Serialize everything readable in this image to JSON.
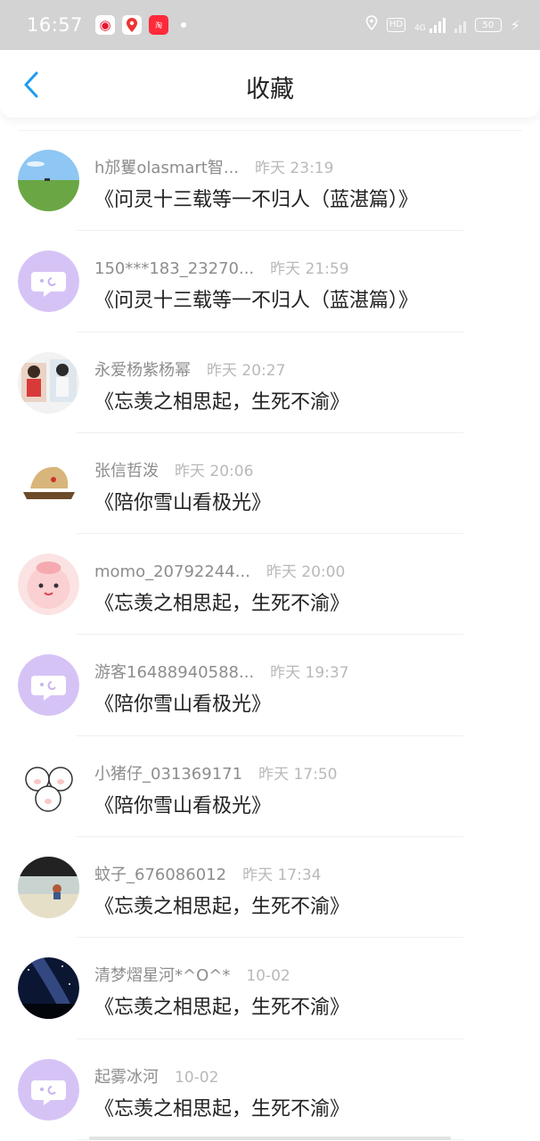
{
  "status_bar": {
    "time": "16:57",
    "apps": [
      {
        "icon": "weibo-icon",
        "glyph": "◉"
      },
      {
        "icon": "map-pin-icon",
        "glyph": "📍"
      },
      {
        "icon": "taobao-icon",
        "glyph": "淘"
      }
    ],
    "network": "4G",
    "battery": "50"
  },
  "header": {
    "title": "收藏",
    "back_icon": "chevron-left-icon",
    "accent_color": "#1e9bf0"
  },
  "favorites": [
    {
      "user": "h邡矍olasmart智...",
      "time": "昨天 23:19",
      "story": "《问灵十三载等一不归人（蓝湛篇）》",
      "avatar": "field"
    },
    {
      "user": "150***183_23270...",
      "time": "昨天 21:59",
      "story": "《问灵十三载等一不归人（蓝湛篇）》",
      "avatar": "default"
    },
    {
      "user": "永爱杨紫杨幂",
      "time": "昨天 20:27",
      "story": "《忘羡之相思起，生死不渝》",
      "avatar": "couple"
    },
    {
      "user": "张信哲泼",
      "time": "昨天 20:06",
      "story": "《陪你雪山看极光》",
      "avatar": "hat"
    },
    {
      "user": "momo_20792244...",
      "time": "昨天 20:00",
      "story": "《忘羡之相思起，生死不渝》",
      "avatar": "pink"
    },
    {
      "user": "游客16488940588...",
      "time": "昨天 19:37",
      "story": "《陪你雪山看极光》",
      "avatar": "default"
    },
    {
      "user": "小猪仔_031369171",
      "time": "昨天 17:50",
      "story": "《陪你雪山看极光》",
      "avatar": "pig"
    },
    {
      "user": "蚊子_676086012",
      "time": "昨天 17:34",
      "story": "《忘羡之相思起，生死不渝》",
      "avatar": "beach"
    },
    {
      "user": "清梦熠星河*^O^*",
      "time": "10-02",
      "story": "《忘羡之相思起，生死不渝》",
      "avatar": "night"
    },
    {
      "user": "起雾冰河",
      "time": "10-02",
      "story": "《忘羡之相思起，生死不渝》",
      "avatar": "default"
    }
  ]
}
